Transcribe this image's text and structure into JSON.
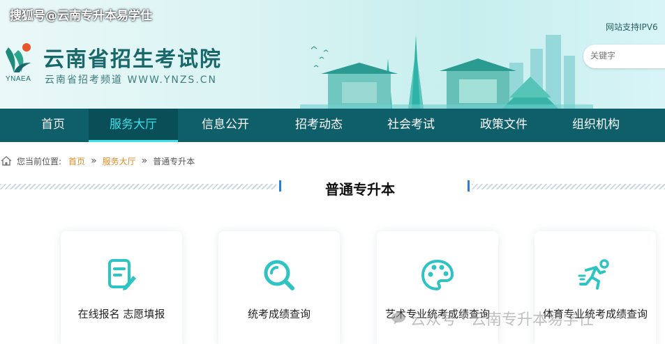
{
  "watermark_top": "搜狐号@云南专升本易学仕",
  "header": {
    "logo_abbr": "YNAEA",
    "title": "云南省招生考试院",
    "subtitle": "云南省招考频道 WWW.YNZS.CN",
    "ipv6": "网站支持IPV6",
    "search_placeholder": "关键字"
  },
  "nav": {
    "items": [
      "首页",
      "服务大厅",
      "信息公开",
      "招考动态",
      "社会考试",
      "政策文件",
      "组织机构"
    ],
    "active": "服务大厅"
  },
  "breadcrumb": {
    "prefix": "您当前位置:",
    "home": "首页",
    "service": "服务大厅",
    "current": "普通专升本"
  },
  "section_title": "普通专升本",
  "cards": [
    {
      "label": "在线报名 志愿填报",
      "icon": "form-edit-icon"
    },
    {
      "label": "统考成绩查询",
      "icon": "search-icon"
    },
    {
      "label": "艺术专业统考成绩查询",
      "icon": "palette-icon"
    },
    {
      "label": "体育专业统考成绩查询",
      "icon": "runner-icon"
    }
  ],
  "watermark_bottom": "云众号 · 云南专升本易学仕",
  "colors": {
    "nav_bg": "#0f5f6a",
    "nav_active_text": "#3fe0e6",
    "accent": "#2ec4c4",
    "crumb_link": "#e08a27"
  }
}
